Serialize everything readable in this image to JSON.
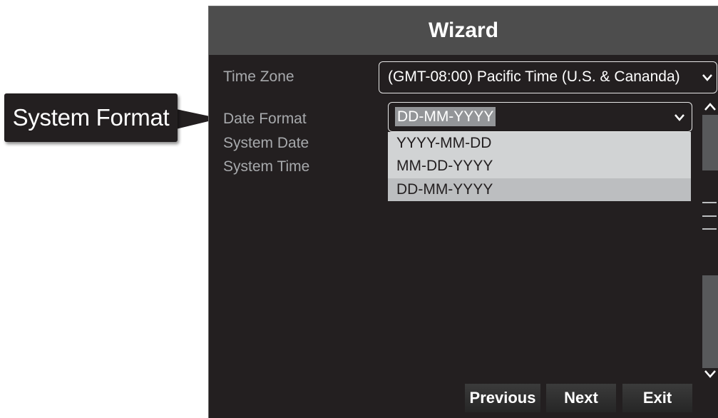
{
  "callout": {
    "label": "System Format"
  },
  "wizard": {
    "title": "Wizard",
    "labels": {
      "time_zone": "Time Zone",
      "date_format": "Date Format",
      "system_date": "System Date",
      "system_time": "System Time"
    },
    "time_zone": {
      "value": "(GMT-08:00) Pacific Time (U.S. & Cananda)"
    },
    "date_format": {
      "value": "DD-MM-YYYY",
      "options": [
        "YYYY-MM-DD",
        "MM-DD-YYYY",
        "DD-MM-YYYY"
      ],
      "selected_index": 2
    },
    "buttons": {
      "previous": "Previous",
      "next": "Next",
      "exit": "Exit"
    }
  },
  "colors": {
    "window_bg": "#231f20",
    "title_bg": "#4d4d4d",
    "label_text": "#a7a9ac",
    "dropdown_bg": "#d1d3d4",
    "dropdown_selected": "#bcbec0"
  },
  "icons": {
    "select_arrow": "chevron-down-icon",
    "scroll_up": "chevron-up-icon",
    "scroll_down": "chevron-down-icon"
  }
}
